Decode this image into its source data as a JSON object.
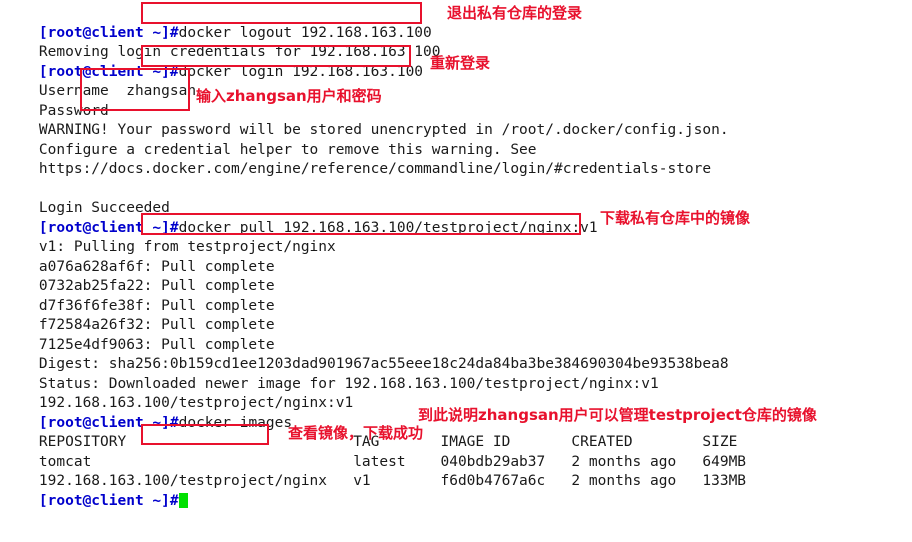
{
  "terminal": {
    "prompt": "[root@client ~]#",
    "cursor": "block-cursor",
    "lines": [
      {
        "id": "l1",
        "prompt": "[root@client ~]#",
        "text": "docker logout 192.168.163.100"
      },
      {
        "id": "l2",
        "prompt": "",
        "text": "Removing login credentials for 192.168.163.100"
      },
      {
        "id": "l3",
        "prompt": "[root@client ~]#",
        "text": "docker login 192.168.163.100"
      },
      {
        "id": "l4",
        "prompt": "",
        "text": "Username  zhangsan"
      },
      {
        "id": "l5",
        "prompt": "",
        "text": "Password"
      },
      {
        "id": "l6",
        "prompt": "",
        "text": "WARNING! Your password will be stored unencrypted in /root/.docker/config.json."
      },
      {
        "id": "l7",
        "prompt": "",
        "text": "Configure a credential helper to remove this warning. See"
      },
      {
        "id": "l8",
        "prompt": "",
        "text": "https://docs.docker.com/engine/reference/commandline/login/#credentials-store"
      },
      {
        "id": "l9",
        "prompt": "",
        "text": ""
      },
      {
        "id": "l10",
        "prompt": "",
        "text": "Login Succeeded"
      },
      {
        "id": "l11",
        "prompt": "[root@client ~]#",
        "text": "docker pull 192.168.163.100/testproject/nginx:v1"
      },
      {
        "id": "l12",
        "prompt": "",
        "text": "v1: Pulling from testproject/nginx"
      },
      {
        "id": "l13",
        "prompt": "",
        "text": "a076a628af6f: Pull complete"
      },
      {
        "id": "l14",
        "prompt": "",
        "text": "0732ab25fa22: Pull complete"
      },
      {
        "id": "l15",
        "prompt": "",
        "text": "d7f36f6fe38f: Pull complete"
      },
      {
        "id": "l16",
        "prompt": "",
        "text": "f72584a26f32: Pull complete"
      },
      {
        "id": "l17",
        "prompt": "",
        "text": "7125e4df9063: Pull complete"
      },
      {
        "id": "l18",
        "prompt": "",
        "text": "Digest: sha256:0b159cd1ee1203dad901967ac55eee18c24da84ba3be384690304be93538bea8"
      },
      {
        "id": "l19",
        "prompt": "",
        "text": "Status: Downloaded newer image for 192.168.163.100/testproject/nginx:v1"
      },
      {
        "id": "l20",
        "prompt": "",
        "text": "192.168.163.100/testproject/nginx:v1"
      },
      {
        "id": "l21",
        "prompt": "[root@client ~]#",
        "text": "docker images"
      },
      {
        "id": "l22",
        "prompt": "",
        "text": "REPOSITORY                          TAG       IMAGE ID       CREATED        SIZE"
      },
      {
        "id": "l23",
        "prompt": "",
        "text": "tomcat                              latest    040bdb29ab37   2 months ago   649MB"
      },
      {
        "id": "l24",
        "prompt": "",
        "text": "192.168.163.100/testproject/nginx   v1        f6d0b4767a6c   2 months ago   133MB"
      },
      {
        "id": "l25",
        "prompt": "[root@client ~]#",
        "text": "",
        "cursor": true
      }
    ]
  },
  "images_table": {
    "headers": [
      "REPOSITORY",
      "TAG",
      "IMAGE ID",
      "CREATED",
      "SIZE"
    ],
    "rows": [
      [
        "tomcat",
        "latest",
        "040bdb29ab37",
        "2 months ago",
        "649MB"
      ],
      [
        "192.168.163.100/testproject/nginx",
        "v1",
        "f6d0b4767a6c",
        "2 months ago",
        "133MB"
      ]
    ]
  },
  "annotations": {
    "accent_color": "#e8112d",
    "notes": [
      {
        "id": "a1",
        "text": "退出私有仓库的登录"
      },
      {
        "id": "a2",
        "text": "重新登录"
      },
      {
        "id": "a3",
        "text": "输入zhangsan用户和密码"
      },
      {
        "id": "a4",
        "text": "下载私有仓库中的镜像"
      },
      {
        "id": "a5",
        "text": "到此说明zhangsan用户可以管理testproject仓库的镜像"
      },
      {
        "id": "a6",
        "text": "查看镜像，下载成功"
      }
    ],
    "boxes": [
      {
        "id": "b1",
        "target": "docker logout 192.168.163.100"
      },
      {
        "id": "b2",
        "target": "docker login 192.168.163.100"
      },
      {
        "id": "b3",
        "target": "zhangsan"
      },
      {
        "id": "b4",
        "target": "docker pull 192.168.163.100/testproject/nginx:v1"
      },
      {
        "id": "b5",
        "target": "docker images"
      }
    ]
  }
}
